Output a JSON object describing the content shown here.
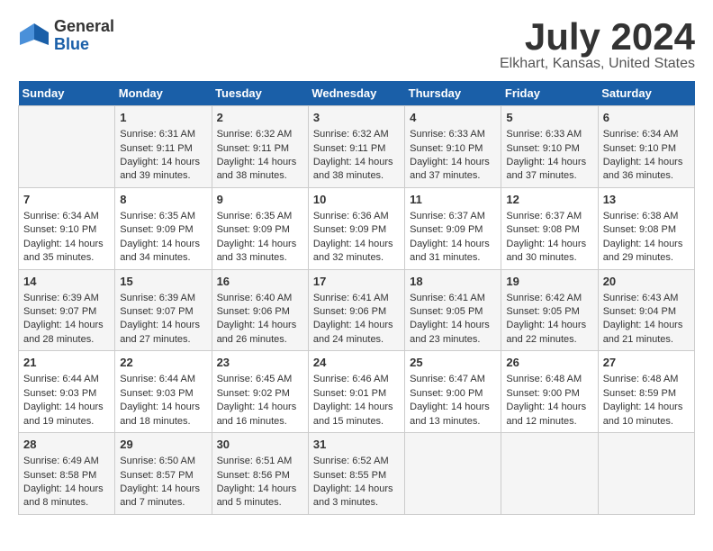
{
  "header": {
    "logo_general": "General",
    "logo_blue": "Blue",
    "month": "July 2024",
    "location": "Elkhart, Kansas, United States"
  },
  "calendar": {
    "days_of_week": [
      "Sunday",
      "Monday",
      "Tuesday",
      "Wednesday",
      "Thursday",
      "Friday",
      "Saturday"
    ],
    "weeks": [
      [
        {
          "day": "",
          "data": ""
        },
        {
          "day": "1",
          "data": "Sunrise: 6:31 AM\nSunset: 9:11 PM\nDaylight: 14 hours\nand 39 minutes."
        },
        {
          "day": "2",
          "data": "Sunrise: 6:32 AM\nSunset: 9:11 PM\nDaylight: 14 hours\nand 38 minutes."
        },
        {
          "day": "3",
          "data": "Sunrise: 6:32 AM\nSunset: 9:11 PM\nDaylight: 14 hours\nand 38 minutes."
        },
        {
          "day": "4",
          "data": "Sunrise: 6:33 AM\nSunset: 9:10 PM\nDaylight: 14 hours\nand 37 minutes."
        },
        {
          "day": "5",
          "data": "Sunrise: 6:33 AM\nSunset: 9:10 PM\nDaylight: 14 hours\nand 37 minutes."
        },
        {
          "day": "6",
          "data": "Sunrise: 6:34 AM\nSunset: 9:10 PM\nDaylight: 14 hours\nand 36 minutes."
        }
      ],
      [
        {
          "day": "7",
          "data": "Sunrise: 6:34 AM\nSunset: 9:10 PM\nDaylight: 14 hours\nand 35 minutes."
        },
        {
          "day": "8",
          "data": "Sunrise: 6:35 AM\nSunset: 9:09 PM\nDaylight: 14 hours\nand 34 minutes."
        },
        {
          "day": "9",
          "data": "Sunrise: 6:35 AM\nSunset: 9:09 PM\nDaylight: 14 hours\nand 33 minutes."
        },
        {
          "day": "10",
          "data": "Sunrise: 6:36 AM\nSunset: 9:09 PM\nDaylight: 14 hours\nand 32 minutes."
        },
        {
          "day": "11",
          "data": "Sunrise: 6:37 AM\nSunset: 9:09 PM\nDaylight: 14 hours\nand 31 minutes."
        },
        {
          "day": "12",
          "data": "Sunrise: 6:37 AM\nSunset: 9:08 PM\nDaylight: 14 hours\nand 30 minutes."
        },
        {
          "day": "13",
          "data": "Sunrise: 6:38 AM\nSunset: 9:08 PM\nDaylight: 14 hours\nand 29 minutes."
        }
      ],
      [
        {
          "day": "14",
          "data": "Sunrise: 6:39 AM\nSunset: 9:07 PM\nDaylight: 14 hours\nand 28 minutes."
        },
        {
          "day": "15",
          "data": "Sunrise: 6:39 AM\nSunset: 9:07 PM\nDaylight: 14 hours\nand 27 minutes."
        },
        {
          "day": "16",
          "data": "Sunrise: 6:40 AM\nSunset: 9:06 PM\nDaylight: 14 hours\nand 26 minutes."
        },
        {
          "day": "17",
          "data": "Sunrise: 6:41 AM\nSunset: 9:06 PM\nDaylight: 14 hours\nand 24 minutes."
        },
        {
          "day": "18",
          "data": "Sunrise: 6:41 AM\nSunset: 9:05 PM\nDaylight: 14 hours\nand 23 minutes."
        },
        {
          "day": "19",
          "data": "Sunrise: 6:42 AM\nSunset: 9:05 PM\nDaylight: 14 hours\nand 22 minutes."
        },
        {
          "day": "20",
          "data": "Sunrise: 6:43 AM\nSunset: 9:04 PM\nDaylight: 14 hours\nand 21 minutes."
        }
      ],
      [
        {
          "day": "21",
          "data": "Sunrise: 6:44 AM\nSunset: 9:03 PM\nDaylight: 14 hours\nand 19 minutes."
        },
        {
          "day": "22",
          "data": "Sunrise: 6:44 AM\nSunset: 9:03 PM\nDaylight: 14 hours\nand 18 minutes."
        },
        {
          "day": "23",
          "data": "Sunrise: 6:45 AM\nSunset: 9:02 PM\nDaylight: 14 hours\nand 16 minutes."
        },
        {
          "day": "24",
          "data": "Sunrise: 6:46 AM\nSunset: 9:01 PM\nDaylight: 14 hours\nand 15 minutes."
        },
        {
          "day": "25",
          "data": "Sunrise: 6:47 AM\nSunset: 9:00 PM\nDaylight: 14 hours\nand 13 minutes."
        },
        {
          "day": "26",
          "data": "Sunrise: 6:48 AM\nSunset: 9:00 PM\nDaylight: 14 hours\nand 12 minutes."
        },
        {
          "day": "27",
          "data": "Sunrise: 6:48 AM\nSunset: 8:59 PM\nDaylight: 14 hours\nand 10 minutes."
        }
      ],
      [
        {
          "day": "28",
          "data": "Sunrise: 6:49 AM\nSunset: 8:58 PM\nDaylight: 14 hours\nand 8 minutes."
        },
        {
          "day": "29",
          "data": "Sunrise: 6:50 AM\nSunset: 8:57 PM\nDaylight: 14 hours\nand 7 minutes."
        },
        {
          "day": "30",
          "data": "Sunrise: 6:51 AM\nSunset: 8:56 PM\nDaylight: 14 hours\nand 5 minutes."
        },
        {
          "day": "31",
          "data": "Sunrise: 6:52 AM\nSunset: 8:55 PM\nDaylight: 14 hours\nand 3 minutes."
        },
        {
          "day": "",
          "data": ""
        },
        {
          "day": "",
          "data": ""
        },
        {
          "day": "",
          "data": ""
        }
      ]
    ]
  }
}
